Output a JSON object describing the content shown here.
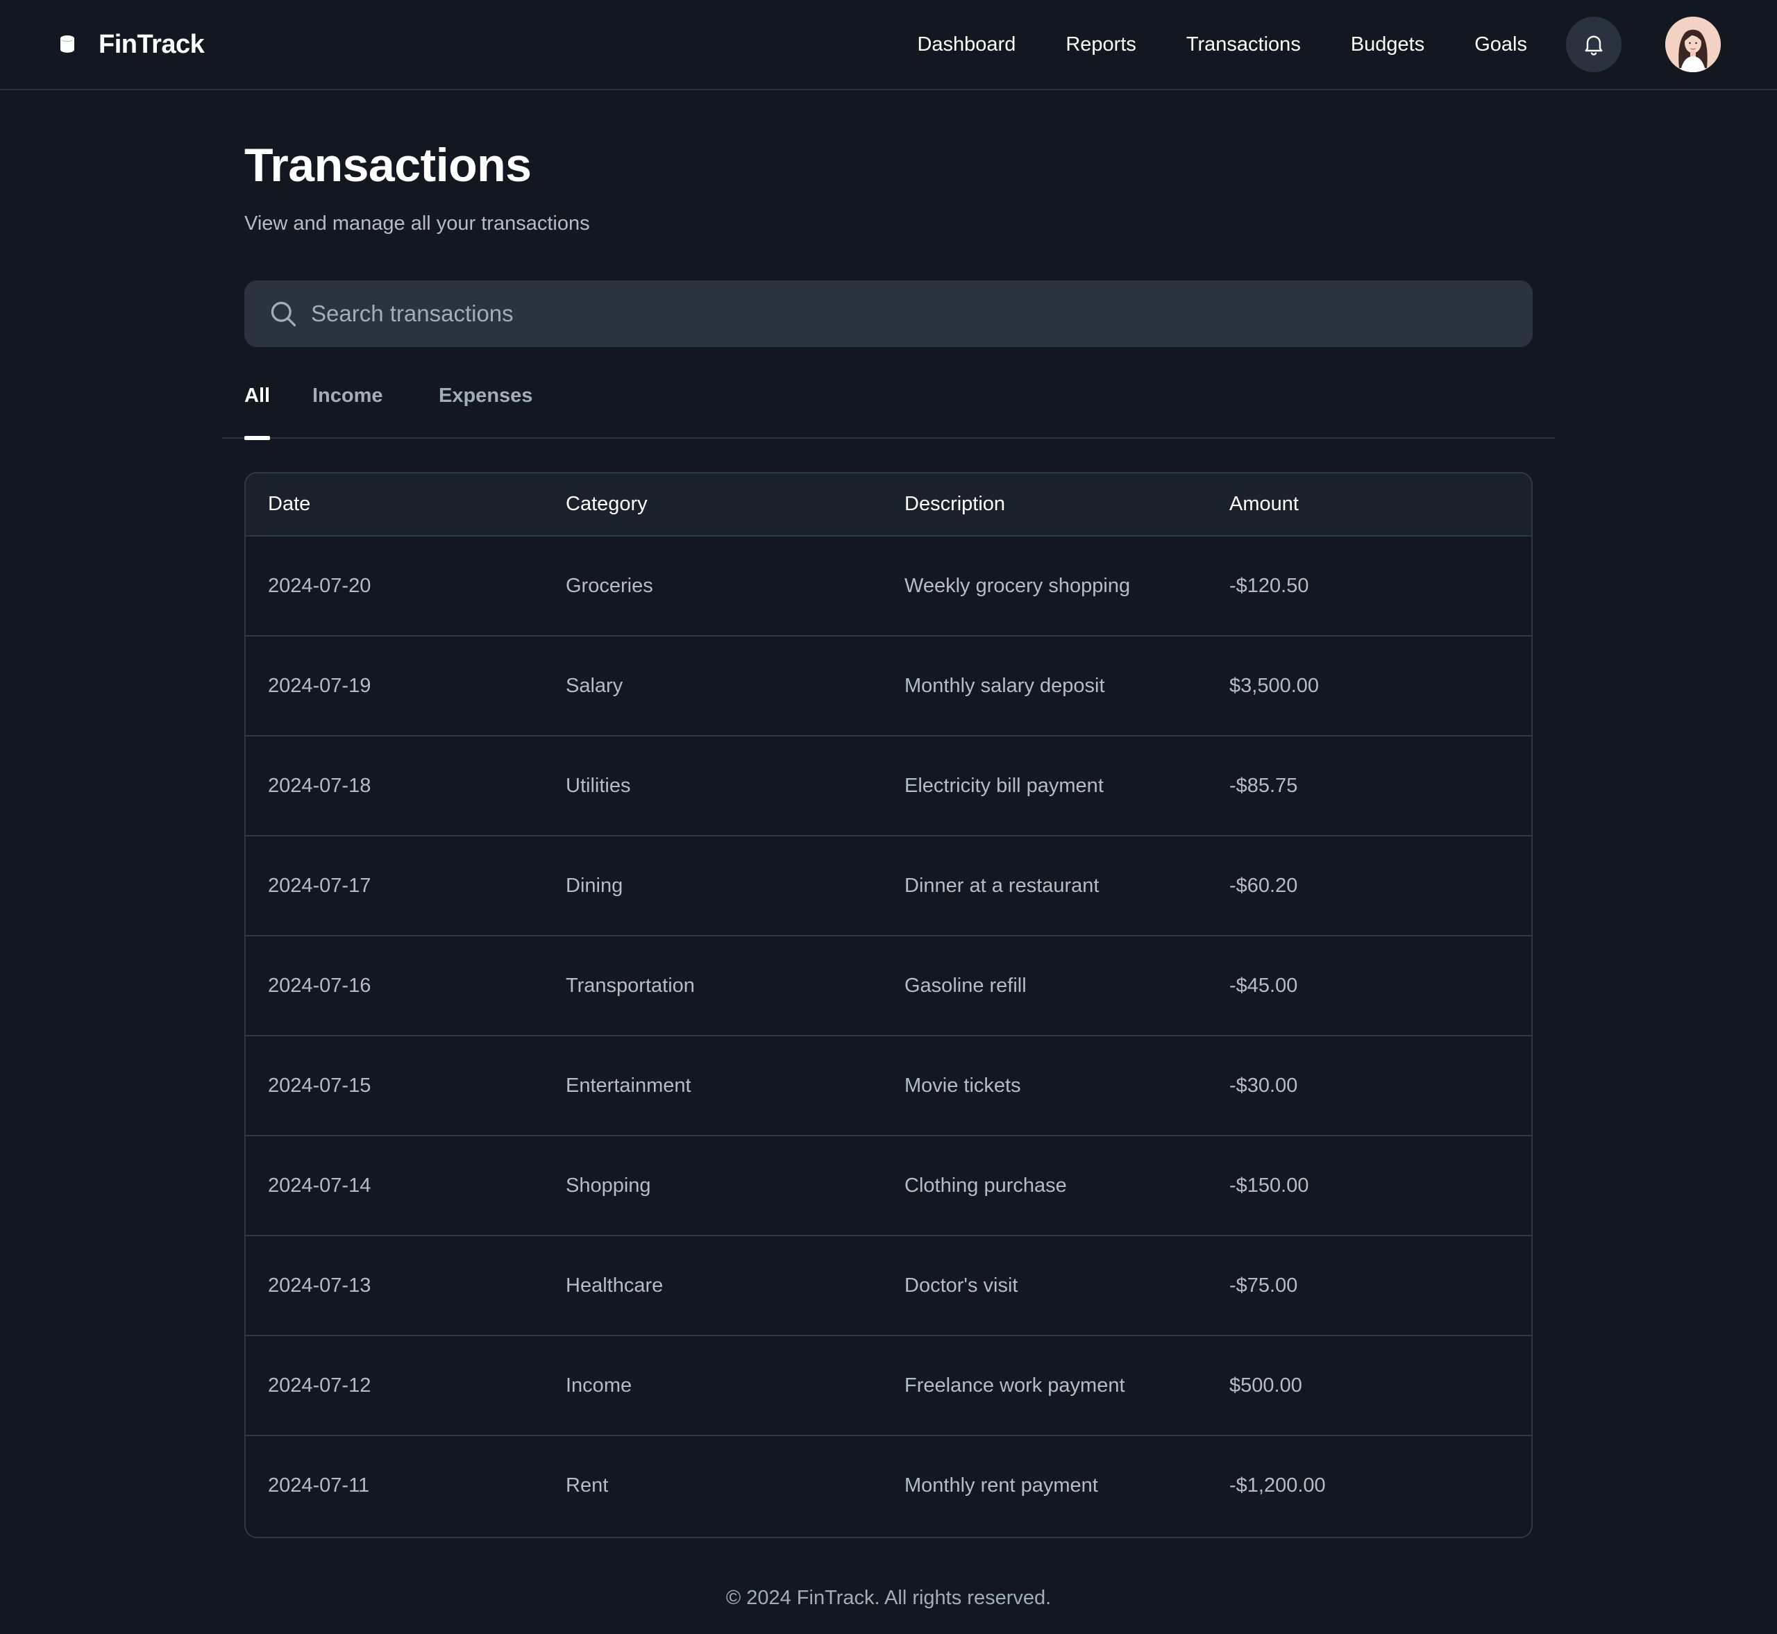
{
  "header": {
    "brand": "FinTrack",
    "nav": [
      "Dashboard",
      "Reports",
      "Transactions",
      "Budgets",
      "Goals"
    ],
    "icons": {
      "brand": "database-icon",
      "notifications": "bell-icon",
      "avatar": "user-avatar"
    }
  },
  "page": {
    "title": "Transactions",
    "subtitle": "View and manage all your transactions"
  },
  "search": {
    "placeholder": "Search transactions",
    "value": ""
  },
  "tabs": [
    {
      "label": "All",
      "active": true
    },
    {
      "label": "Income",
      "active": false
    },
    {
      "label": "Expenses",
      "active": false
    }
  ],
  "table": {
    "columns": [
      "Date",
      "Category",
      "Description",
      "Amount"
    ],
    "rows": [
      {
        "date": "2024-07-20",
        "category": "Groceries",
        "description": "Weekly grocery shopping",
        "amount": "-$120.50"
      },
      {
        "date": "2024-07-19",
        "category": "Salary",
        "description": "Monthly salary deposit",
        "amount": "$3,500.00"
      },
      {
        "date": "2024-07-18",
        "category": "Utilities",
        "description": "Electricity bill payment",
        "amount": "-$85.75"
      },
      {
        "date": "2024-07-17",
        "category": "Dining",
        "description": "Dinner at a restaurant",
        "amount": "-$60.20"
      },
      {
        "date": "2024-07-16",
        "category": "Transportation",
        "description": "Gasoline refill",
        "amount": "-$45.00"
      },
      {
        "date": "2024-07-15",
        "category": "Entertainment",
        "description": "Movie tickets",
        "amount": "-$30.00"
      },
      {
        "date": "2024-07-14",
        "category": "Shopping",
        "description": "Clothing purchase",
        "amount": "-$150.00"
      },
      {
        "date": "2024-07-13",
        "category": "Healthcare",
        "description": "Doctor's visit",
        "amount": "-$75.00"
      },
      {
        "date": "2024-07-12",
        "category": "Income",
        "description": "Freelance work payment",
        "amount": "$500.00"
      },
      {
        "date": "2024-07-11",
        "category": "Rent",
        "description": "Monthly rent payment",
        "amount": "-$1,200.00"
      }
    ]
  },
  "footer": {
    "text": "© 2024 FinTrack. All rights reserved."
  },
  "colors": {
    "background": "#131820",
    "surface": "#1b212a",
    "input": "#2a333f",
    "border": "#2f3743",
    "text": "#ffffff",
    "muted": "#b4bcc8"
  }
}
